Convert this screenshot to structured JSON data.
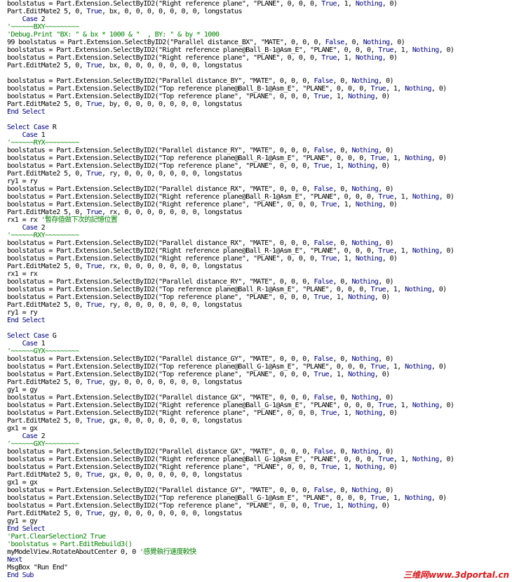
{
  "colors": {
    "text": "#000000",
    "keyword": "#00007f",
    "comment": "#008000",
    "watermark": "#d9191c"
  },
  "watermark": "三维网www.3dportal.cn",
  "lines": [
    [
      [
        "boolstatus = Part.Extension.SelectByID2(\"Right reference plane\", \"PLANE\", 0, 0, 0, ",
        "n"
      ],
      [
        "True",
        "k"
      ],
      [
        ", 1, ",
        "n"
      ],
      [
        "Nothing",
        "k"
      ],
      [
        ", 0)",
        "n"
      ]
    ],
    [
      [
        "Part.EditMate2 5, 0, ",
        "n"
      ],
      [
        "True",
        "k"
      ],
      [
        ", bx, 0, 0, 0, 0, 0, 0, 0, longstatus",
        "n"
      ]
    ],
    [
      [
        "    ",
        "n"
      ],
      [
        "Case",
        "k"
      ],
      [
        " 2",
        "n"
      ]
    ],
    [
      [
        "'~~~~~~BXY~~~~~~~~~",
        "c"
      ]
    ],
    [
      [
        "'Debug.Print \"BX: \" & bx * 1000 & \"  , BY: \" & by * 1000",
        "c"
      ]
    ],
    [
      [
        "99 boolstatus = Part.Extension.SelectByID2(\"Parallel distance_BX\", \"MATE\", 0, 0, 0, ",
        "n"
      ],
      [
        "False",
        "k"
      ],
      [
        ", 0, ",
        "n"
      ],
      [
        "Nothing",
        "k"
      ],
      [
        ", 0)",
        "n"
      ]
    ],
    [
      [
        "boolstatus = Part.Extension.SelectByID2(\"Right reference plane@Ball_B-1@Asm_E\", \"PLANE\", 0, 0, 0, ",
        "n"
      ],
      [
        "True",
        "k"
      ],
      [
        ", 1, ",
        "n"
      ],
      [
        "Nothing",
        "k"
      ],
      [
        ", 0)",
        "n"
      ]
    ],
    [
      [
        "boolstatus = Part.Extension.SelectByID2(\"Right reference plane\", \"PLANE\", 0, 0, 0, ",
        "n"
      ],
      [
        "True",
        "k"
      ],
      [
        ", 1, ",
        "n"
      ],
      [
        "Nothing",
        "k"
      ],
      [
        ", 0)",
        "n"
      ]
    ],
    [
      [
        "Part.EditMate2 5, 0, ",
        "n"
      ],
      [
        "True",
        "k"
      ],
      [
        ", bx, 0, 0, 0, 0, 0, 0, 0, longstatus",
        "n"
      ]
    ],
    [],
    [
      [
        "boolstatus = Part.Extension.SelectByID2(\"Parallel distance_BY\", \"MATE\", 0, 0, 0, ",
        "n"
      ],
      [
        "False",
        "k"
      ],
      [
        ", 0, ",
        "n"
      ],
      [
        "Nothing",
        "k"
      ],
      [
        ", 0)",
        "n"
      ]
    ],
    [
      [
        "boolstatus = Part.Extension.SelectByID2(\"Top reference plane@Ball_B-1@Asm_E\", \"PLANE\", 0, 0, 0, ",
        "n"
      ],
      [
        "True",
        "k"
      ],
      [
        ", 1, ",
        "n"
      ],
      [
        "Nothing",
        "k"
      ],
      [
        ", 0)",
        "n"
      ]
    ],
    [
      [
        "boolstatus = Part.Extension.SelectByID2(\"Top reference plane\", \"PLANE\", 0, 0, 0, ",
        "n"
      ],
      [
        "True",
        "k"
      ],
      [
        ", 1, ",
        "n"
      ],
      [
        "Nothing",
        "k"
      ],
      [
        ", 0)",
        "n"
      ]
    ],
    [
      [
        "Part.EditMate2 5, 0, ",
        "n"
      ],
      [
        "True",
        "k"
      ],
      [
        ", by, 0, 0, 0, 0, 0, 0, 0, longstatus",
        "n"
      ]
    ],
    [
      [
        "End Select",
        "k"
      ]
    ],
    [],
    [
      [
        "Select Case",
        "k"
      ],
      [
        " R",
        "n"
      ]
    ],
    [
      [
        "    ",
        "n"
      ],
      [
        "Case",
        "k"
      ],
      [
        " 1",
        "n"
      ]
    ],
    [
      [
        "'~~~~~~RYX~~~~~~~~~",
        "c"
      ]
    ],
    [
      [
        "boolstatus = Part.Extension.SelectByID2(\"Parallel distance_RY\", \"MATE\", 0, 0, 0, ",
        "n"
      ],
      [
        "False",
        "k"
      ],
      [
        ", 0, ",
        "n"
      ],
      [
        "Nothing",
        "k"
      ],
      [
        ", 0)",
        "n"
      ]
    ],
    [
      [
        "boolstatus = Part.Extension.SelectByID2(\"Top reference plane@Ball_R-1@Asm_E\", \"PLANE\", 0, 0, 0, ",
        "n"
      ],
      [
        "True",
        "k"
      ],
      [
        ", 1, ",
        "n"
      ],
      [
        "Nothing",
        "k"
      ],
      [
        ", 0)",
        "n"
      ]
    ],
    [
      [
        "boolstatus = Part.Extension.SelectByID2(\"Top reference plane\", \"PLANE\", 0, 0, 0, ",
        "n"
      ],
      [
        "True",
        "k"
      ],
      [
        ", 1, ",
        "n"
      ],
      [
        "Nothing",
        "k"
      ],
      [
        ", 0)",
        "n"
      ]
    ],
    [
      [
        "Part.EditMate2 5, 0, ",
        "n"
      ],
      [
        "True",
        "k"
      ],
      [
        ", ry, 0, 0, 0, 0, 0, 0, 0, longstatus",
        "n"
      ]
    ],
    [
      [
        "ry1 = ry",
        "n"
      ]
    ],
    [
      [
        "boolstatus = Part.Extension.SelectByID2(\"Parallel distance_RX\", \"MATE\", 0, 0, 0, ",
        "n"
      ],
      [
        "False",
        "k"
      ],
      [
        ", 0, ",
        "n"
      ],
      [
        "Nothing",
        "k"
      ],
      [
        ", 0)",
        "n"
      ]
    ],
    [
      [
        "boolstatus = Part.Extension.SelectByID2(\"Right reference plane@Ball_R-1@Asm_E\", \"PLANE\", 0, 0, 0, ",
        "n"
      ],
      [
        "True",
        "k"
      ],
      [
        ", 1, ",
        "n"
      ],
      [
        "Nothing",
        "k"
      ],
      [
        ", 0)",
        "n"
      ]
    ],
    [
      [
        "boolstatus = Part.Extension.SelectByID2(\"Right reference plane\", \"PLANE\", 0, 0, 0, ",
        "n"
      ],
      [
        "True",
        "k"
      ],
      [
        ", 1, ",
        "n"
      ],
      [
        "Nothing",
        "k"
      ],
      [
        ", 0)",
        "n"
      ]
    ],
    [
      [
        "Part.EditMate2 5, 0, ",
        "n"
      ],
      [
        "True",
        "k"
      ],
      [
        ", rx, 0, 0, 0, 0, 0, 0, 0, longstatus",
        "n"
      ]
    ],
    [
      [
        "rx1 = rx ",
        "n"
      ],
      [
        "'暫存值做下次的記憶位置",
        "c"
      ]
    ],
    [
      [
        "    ",
        "n"
      ],
      [
        "Case",
        "k"
      ],
      [
        " 2",
        "n"
      ]
    ],
    [
      [
        "'~~~~~~RXY~~~~~~~~~",
        "c"
      ]
    ],
    [
      [
        "boolstatus = Part.Extension.SelectByID2(\"Parallel distance_RX\", \"MATE\", 0, 0, 0, ",
        "n"
      ],
      [
        "False",
        "k"
      ],
      [
        ", 0, ",
        "n"
      ],
      [
        "Nothing",
        "k"
      ],
      [
        ", 0)",
        "n"
      ]
    ],
    [
      [
        "boolstatus = Part.Extension.SelectByID2(\"Right reference plane@Ball_R-1@Asm_E\", \"PLANE\", 0, 0, 0, ",
        "n"
      ],
      [
        "True",
        "k"
      ],
      [
        ", 1, ",
        "n"
      ],
      [
        "Nothing",
        "k"
      ],
      [
        ", 0)",
        "n"
      ]
    ],
    [
      [
        "boolstatus = Part.Extension.SelectByID2(\"Right reference plane\", \"PLANE\", 0, 0, 0, ",
        "n"
      ],
      [
        "True",
        "k"
      ],
      [
        ", 1, ",
        "n"
      ],
      [
        "Nothing",
        "k"
      ],
      [
        ", 0)",
        "n"
      ]
    ],
    [
      [
        "Part.EditMate2 5, 0, ",
        "n"
      ],
      [
        "True",
        "k"
      ],
      [
        ", rx, 0, 0, 0, 0, 0, 0, 0, longstatus",
        "n"
      ]
    ],
    [
      [
        "rx1 = rx",
        "n"
      ]
    ],
    [
      [
        "boolstatus = Part.Extension.SelectByID2(\"Parallel distance_RY\", \"MATE\", 0, 0, 0, ",
        "n"
      ],
      [
        "False",
        "k"
      ],
      [
        ", 0, ",
        "n"
      ],
      [
        "Nothing",
        "k"
      ],
      [
        ", 0)",
        "n"
      ]
    ],
    [
      [
        "boolstatus = Part.Extension.SelectByID2(\"Top reference plane@Ball_R-1@Asm_E\", \"PLANE\", 0, 0, 0, ",
        "n"
      ],
      [
        "True",
        "k"
      ],
      [
        ", 1, ",
        "n"
      ],
      [
        "Nothing",
        "k"
      ],
      [
        ", 0)",
        "n"
      ]
    ],
    [
      [
        "boolstatus = Part.Extension.SelectByID2(\"Top reference plane\", \"PLANE\", 0, 0, 0, ",
        "n"
      ],
      [
        "True",
        "k"
      ],
      [
        ", 1, ",
        "n"
      ],
      [
        "Nothing",
        "k"
      ],
      [
        ", 0)",
        "n"
      ]
    ],
    [
      [
        "Part.EditMate2 5, 0, ",
        "n"
      ],
      [
        "True",
        "k"
      ],
      [
        ", ry, 0, 0, 0, 0, 0, 0, 0, longstatus",
        "n"
      ]
    ],
    [
      [
        "ry1 = ry",
        "n"
      ]
    ],
    [
      [
        "End Select",
        "k"
      ]
    ],
    [],
    [
      [
        "Select Case",
        "k"
      ],
      [
        " G",
        "n"
      ]
    ],
    [
      [
        "    ",
        "n"
      ],
      [
        "Case",
        "k"
      ],
      [
        " 1",
        "n"
      ]
    ],
    [
      [
        "'~~~~~~GYX~~~~~~~~~",
        "c"
      ]
    ],
    [
      [
        "boolstatus = Part.Extension.SelectByID2(\"Parallel distance_GY\", \"MATE\", 0, 0, 0, ",
        "n"
      ],
      [
        "False",
        "k"
      ],
      [
        ", 0, ",
        "n"
      ],
      [
        "Nothing",
        "k"
      ],
      [
        ", 0)",
        "n"
      ]
    ],
    [
      [
        "boolstatus = Part.Extension.SelectByID2(\"Top reference plane@Ball_G-1@Asm_E\", \"PLANE\", 0, 0, 0, ",
        "n"
      ],
      [
        "True",
        "k"
      ],
      [
        ", 1, ",
        "n"
      ],
      [
        "Nothing",
        "k"
      ],
      [
        ", 0)",
        "n"
      ]
    ],
    [
      [
        "boolstatus = Part.Extension.SelectByID2(\"Top reference plane\", \"PLANE\", 0, 0, 0, ",
        "n"
      ],
      [
        "True",
        "k"
      ],
      [
        ", 1, ",
        "n"
      ],
      [
        "Nothing",
        "k"
      ],
      [
        ", 0)",
        "n"
      ]
    ],
    [
      [
        "Part.EditMate2 5, 0, ",
        "n"
      ],
      [
        "True",
        "k"
      ],
      [
        ", gy, 0, 0, 0, 0, 0, 0, 0, longstatus",
        "n"
      ]
    ],
    [
      [
        "gy1 = gy",
        "n"
      ]
    ],
    [
      [
        "boolstatus = Part.Extension.SelectByID2(\"Parallel distance_GX\", \"MATE\", 0, 0, 0, ",
        "n"
      ],
      [
        "False",
        "k"
      ],
      [
        ", 0, ",
        "n"
      ],
      [
        "Nothing",
        "k"
      ],
      [
        ", 0)",
        "n"
      ]
    ],
    [
      [
        "boolstatus = Part.Extension.SelectByID2(\"Right reference plane@Ball_G-1@Asm_E\", \"PLANE\", 0, 0, 0, ",
        "n"
      ],
      [
        "True",
        "k"
      ],
      [
        ", 1, ",
        "n"
      ],
      [
        "Nothing",
        "k"
      ],
      [
        ", 0)",
        "n"
      ]
    ],
    [
      [
        "boolstatus = Part.Extension.SelectByID2(\"Right reference plane\", \"PLANE\", 0, 0, 0, ",
        "n"
      ],
      [
        "True",
        "k"
      ],
      [
        ", 1, ",
        "n"
      ],
      [
        "Nothing",
        "k"
      ],
      [
        ", 0)",
        "n"
      ]
    ],
    [
      [
        "Part.EditMate2 5, 0, ",
        "n"
      ],
      [
        "True",
        "k"
      ],
      [
        ", gx, 0, 0, 0, 0, 0, 0, 0, longstatus",
        "n"
      ]
    ],
    [
      [
        "gx1 = gx",
        "n"
      ]
    ],
    [
      [
        "    ",
        "n"
      ],
      [
        "Case",
        "k"
      ],
      [
        " 2",
        "n"
      ]
    ],
    [
      [
        "'~~~~~~GXY~~~~~~~~~",
        "c"
      ]
    ],
    [
      [
        "boolstatus = Part.Extension.SelectByID2(\"Parallel distance_GX\", \"MATE\", 0, 0, 0, ",
        "n"
      ],
      [
        "False",
        "k"
      ],
      [
        ", 0, ",
        "n"
      ],
      [
        "Nothing",
        "k"
      ],
      [
        ", 0)",
        "n"
      ]
    ],
    [
      [
        "boolstatus = Part.Extension.SelectByID2(\"Right reference plane@Ball_G-1@Asm_E\", \"PLANE\", 0, 0, 0, ",
        "n"
      ],
      [
        "True",
        "k"
      ],
      [
        ", 1, ",
        "n"
      ],
      [
        "Nothing",
        "k"
      ],
      [
        ", 0)",
        "n"
      ]
    ],
    [
      [
        "boolstatus = Part.Extension.SelectByID2(\"Right reference plane\", \"PLANE\", 0, 0, 0, ",
        "n"
      ],
      [
        "True",
        "k"
      ],
      [
        ", 1, ",
        "n"
      ],
      [
        "Nothing",
        "k"
      ],
      [
        ", 0)",
        "n"
      ]
    ],
    [
      [
        "Part.EditMate2 5, 0, ",
        "n"
      ],
      [
        "True",
        "k"
      ],
      [
        ", gx, 0, 0, 0, 0, 0, 0, 0, longstatus",
        "n"
      ]
    ],
    [
      [
        "gx1 = gx",
        "n"
      ]
    ],
    [
      [
        "boolstatus = Part.Extension.SelectByID2(\"Parallel distance_GY\", \"MATE\", 0, 0, 0, ",
        "n"
      ],
      [
        "False",
        "k"
      ],
      [
        ", 0, ",
        "n"
      ],
      [
        "Nothing",
        "k"
      ],
      [
        ", 0)",
        "n"
      ]
    ],
    [
      [
        "boolstatus = Part.Extension.SelectByID2(\"Top reference plane@Ball_G-1@Asm_E\", \"PLANE\", 0, 0, 0, ",
        "n"
      ],
      [
        "True",
        "k"
      ],
      [
        ", 1, ",
        "n"
      ],
      [
        "Nothing",
        "k"
      ],
      [
        ", 0)",
        "n"
      ]
    ],
    [
      [
        "boolstatus = Part.Extension.SelectByID2(\"Top reference plane\", \"PLANE\", 0, 0, 0, ",
        "n"
      ],
      [
        "True",
        "k"
      ],
      [
        ", 1, ",
        "n"
      ],
      [
        "Nothing",
        "k"
      ],
      [
        ", 0)",
        "n"
      ]
    ],
    [
      [
        "Part.EditMate2 5, 0, ",
        "n"
      ],
      [
        "True",
        "k"
      ],
      [
        ", gy, 0, 0, 0, 0, 0, 0, 0, longstatus",
        "n"
      ]
    ],
    [
      [
        "gy1 = gy",
        "n"
      ]
    ],
    [
      [
        "End Select",
        "k"
      ]
    ],
    [
      [
        "'Part.ClearSelection2 True",
        "c"
      ]
    ],
    [
      [
        "'boolstatus = Part.EditRebuild3()",
        "c"
      ]
    ],
    [
      [
        "myModelView.RotateAboutCenter 0, 0 ",
        "n"
      ],
      [
        "'感覺執行速度較快",
        "c"
      ]
    ],
    [
      [
        "Next",
        "k"
      ]
    ],
    [
      [
        "MsgBox \"Run End\"",
        "n"
      ]
    ],
    [
      [
        "End Sub",
        "k"
      ]
    ]
  ]
}
